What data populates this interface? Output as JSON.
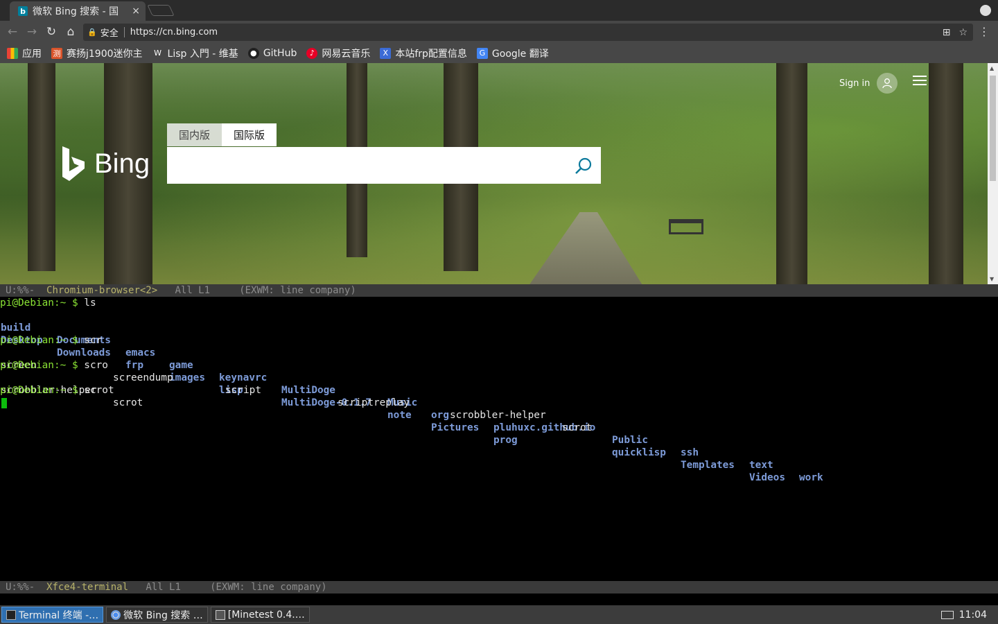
{
  "browser": {
    "tab_title": "微软 Bing 搜索 - 国",
    "security_label": "安全",
    "url": "https://cn.bing.com",
    "bookmarks": [
      {
        "label": "应用",
        "icon": "apps-grid-icon"
      },
      {
        "label": "赛扬j1900迷你主",
        "icon": "site-favicon"
      },
      {
        "label": "Lisp 入門 - 维基",
        "icon": "wikipedia-icon"
      },
      {
        "label": "GitHub",
        "icon": "github-icon"
      },
      {
        "label": "网易云音乐",
        "icon": "netease-music-icon"
      },
      {
        "label": "本站frp配置信息",
        "icon": "site-favicon"
      },
      {
        "label": "Google 翻译",
        "icon": "google-translate-icon"
      }
    ]
  },
  "bing": {
    "logo_text": "Bing",
    "scopes": [
      "国内版",
      "国际版"
    ],
    "active_scope": "国际版",
    "sign_in": "Sign in",
    "search_value": ""
  },
  "emacs": {
    "top_modeline": {
      "status": "U:%%-",
      "buffer": "Chromium-browser<2>",
      "position": "All L1",
      "modes": "(EXWM: line company)"
    },
    "bottom_modeline": {
      "status": "U:%%-",
      "buffer": "Xfce4-terminal",
      "position": "All L1",
      "modes": "(EXWM: line company)"
    }
  },
  "terminal": {
    "prompt": "pi@Debian:~ $ ",
    "commands": [
      "ls",
      "scr",
      "scro",
      "scrot"
    ],
    "ls_row1": [
      "build",
      "Documents",
      "emacs",
      "game",
      "keynavrc",
      "MultiDoge",
      "Music",
      "org",
      "pluhuxc.github.io",
      "Public",
      "ssh",
      "text",
      "work"
    ],
    "ls_row2": [
      "Desktop",
      "Downloads",
      "frp",
      "images",
      "lisp",
      "MultiDoge-0.1.7",
      "note",
      "Pictures",
      "prog",
      "quicklisp",
      "Templates",
      "Videos"
    ],
    "completion1": [
      "screen",
      "screendump",
      "script",
      "scriptreplay",
      "scrobbler-helper",
      "scrot"
    ],
    "completion2": [
      "scrobbler-helper",
      "scrot"
    ]
  },
  "taskbar": {
    "tasks": [
      "Terminal 终端 -…",
      "微软 Bing 搜索 …",
      "[Minetest 0.4.…"
    ],
    "clock": "11:04"
  }
}
